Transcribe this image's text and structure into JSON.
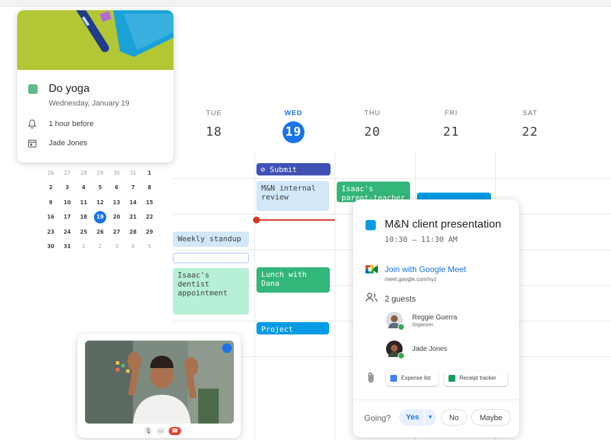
{
  "days": [
    {
      "dow": "TUE",
      "num": "18",
      "today": false
    },
    {
      "dow": "WED",
      "num": "19",
      "today": true
    },
    {
      "dow": "THU",
      "num": "20",
      "today": false
    },
    {
      "dow": "FRI",
      "num": "21",
      "today": false
    },
    {
      "dow": "SAT",
      "num": "22",
      "today": false
    }
  ],
  "events": {
    "submit": "Submit reimburser",
    "mn_review": "M&N internal review",
    "isaac_ptc": "Isaac's parent-teacher conference",
    "weekly_standup": "Weekly standup",
    "isaac_dentist": "Isaac's dentist appointment",
    "lunch": "Lunch with Dana",
    "project": "Project check-in"
  },
  "mini_calendar": [
    [
      "26",
      "27",
      "28",
      "29",
      "30",
      "31",
      "1"
    ],
    [
      "2",
      "3",
      "4",
      "5",
      "6",
      "7",
      "8"
    ],
    [
      "9",
      "10",
      "11",
      "12",
      "13",
      "14",
      "15"
    ],
    [
      "16",
      "17",
      "18",
      "19",
      "20",
      "21",
      "22"
    ],
    [
      "23",
      "24",
      "25",
      "26",
      "27",
      "28",
      "29"
    ],
    [
      "30",
      "31",
      "1",
      "2",
      "3",
      "4",
      "5"
    ]
  ],
  "mini_selected": "19",
  "yoga": {
    "title": "Do yoga",
    "date": "Wednesday, January 19",
    "reminder": "1 hour before",
    "calendar": "Jade Jones",
    "color": "#64b98a"
  },
  "detail": {
    "title": "M&N client presentation",
    "time": "10:30 – 11:30 AM",
    "meet_label": "Join with Google Meet",
    "meet_link": "meet.google.com/xyz",
    "guests_count": "2 guests",
    "guests": [
      {
        "name": "Reggie Guerra",
        "role": "Organizer"
      },
      {
        "name": "Jade Jones",
        "role": ""
      }
    ],
    "attachments": [
      "Expense list",
      "Receipt tracker"
    ],
    "going_label": "Going?",
    "rsvp": {
      "yes": "Yes",
      "no": "No",
      "maybe": "Maybe"
    },
    "color": "#039be5"
  },
  "colors": {
    "accent": "#1a73e8",
    "now_line": "#d93025"
  }
}
